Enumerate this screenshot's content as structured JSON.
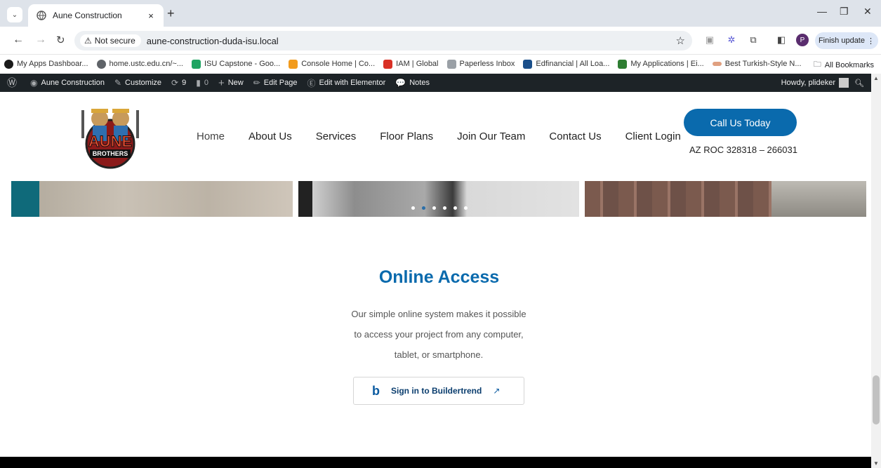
{
  "browser": {
    "tab_title": "Aune Construction",
    "tab_close": "×",
    "new_tab": "+",
    "not_secure_label": "Not secure",
    "url": "aune-construction-duda-isu.local",
    "finish_update": "Finish update",
    "profile_initial": "P",
    "bookmarks": [
      {
        "label": "My Apps Dashboar...",
        "color": "#1a1a1a"
      },
      {
        "label": "home.ustc.edu.cn/~...",
        "color": "#5f6368"
      },
      {
        "label": "ISU Capstone - Goo...",
        "color": "#1fa463"
      },
      {
        "label": "Console Home | Co...",
        "color": "#f29b1d"
      },
      {
        "label": "IAM | Global",
        "color": "#d93025"
      },
      {
        "label": "Paperless Inbox",
        "color": "#9aa0a6"
      },
      {
        "label": "Edfinancial | All Loa...",
        "color": "#1a4f8a"
      },
      {
        "label": "My Applications | Ei...",
        "color": "#2e7d32"
      },
      {
        "label": "Best Turkish-Style N...",
        "color": "#e0a080"
      }
    ],
    "all_bookmarks": "All Bookmarks"
  },
  "adminbar": {
    "site_name": "Aune Construction",
    "customize": "Customize",
    "updates_count": "9",
    "comments_count": "0",
    "new": "New",
    "edit_page": "Edit Page",
    "edit_elementor": "Edit with Elementor",
    "notes": "Notes",
    "howdy": "Howdy, plideker"
  },
  "header": {
    "logo_text": "AUNE BROTHERS",
    "nav": [
      "Home",
      "About Us",
      "Services",
      "Floor Plans",
      "Join Our Team",
      "Contact Us",
      "Client Login"
    ],
    "cta": "Call Us Today",
    "license": "AZ ROC 328318 – 266031"
  },
  "slider": {
    "dots": 6,
    "active_dot": 1
  },
  "online_access": {
    "title": "Online Access",
    "lines": [
      "Our simple online system makes it possible",
      "to access your project from any computer,",
      "tablet, or smartphone."
    ],
    "button": "Sign in to Buildertrend"
  },
  "colors": {
    "brand": "#0a6aad",
    "adminbar": "#1d2327"
  }
}
